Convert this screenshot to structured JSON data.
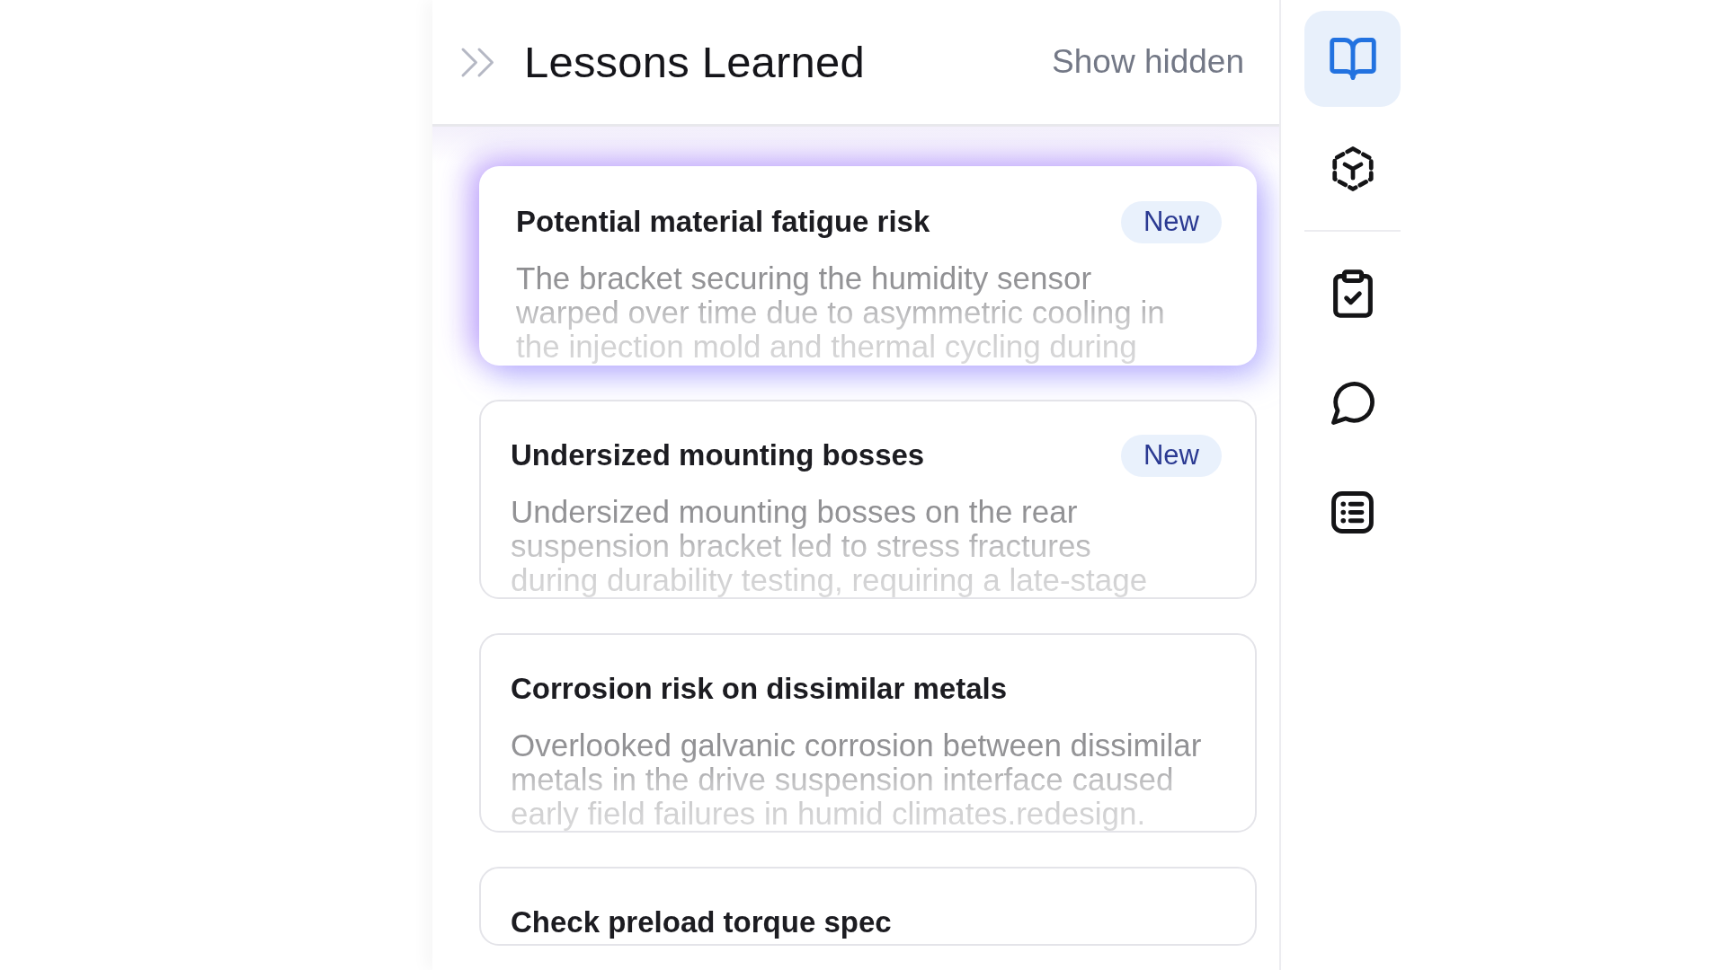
{
  "panel": {
    "title": "Lessons Learned",
    "show_hidden": "Show hidden"
  },
  "lessons": [
    {
      "title": "Potential material fatigue risk",
      "badge": "New",
      "description": "The bracket securing the humidity sensor\nwarped over time due to asymmetric cooling in\nthe injection mold and thermal cycling during",
      "highlighted": true
    },
    {
      "title": "Undersized mounting bosses",
      "badge": "New",
      "description": "Undersized mounting bosses on the rear\nsuspension bracket led to stress fractures\nduring durability testing, requiring a late-stage",
      "highlighted": false
    },
    {
      "title": "Corrosion risk on dissimilar metals",
      "description": "Overlooked galvanic corrosion between dissimilar\nmetals in the drive suspension interface caused\nearly field failures in humid climates.redesign.",
      "highlighted": false
    },
    {
      "title": "Check preload torque spec",
      "highlighted": false
    }
  ],
  "rail": {
    "groups": [
      [
        {
          "selected": true
        },
        {
          "selected": false
        }
      ],
      [
        {
          "selected": false
        },
        {
          "selected": false
        },
        {
          "selected": false
        }
      ]
    ]
  }
}
